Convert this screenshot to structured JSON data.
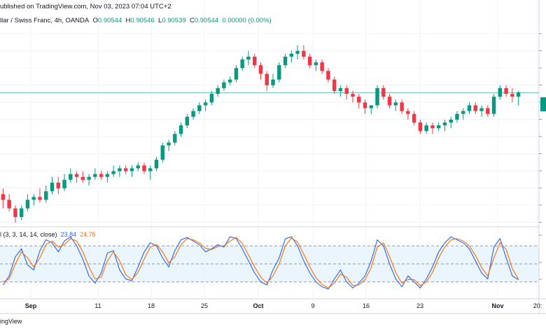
{
  "header": {
    "published_text": "ublished on TradingView.com, Nov 03, 2023 07:04 UTC+2",
    "symbol_text": "llar / Swiss Franc, 4h, OANDA",
    "ohlc": [
      {
        "label": "O",
        "value": "0.90544"
      },
      {
        "label": "H",
        "value": "0.90546"
      },
      {
        "label": "L",
        "value": "0.90539"
      },
      {
        "label": "C",
        "value": "0.90544"
      }
    ],
    "change": "0.00000 (0.00%)"
  },
  "stoch": {
    "title": "l (3, 3, 14, 14, close)",
    "k_value": "23.84",
    "d_value": "24.75"
  },
  "footer": {
    "text": "ingView"
  },
  "colors": {
    "up": "#089981",
    "down": "#f23645",
    "k_line": "#2962ff",
    "d_line": "#ff6d00",
    "band_fill": "#e3f2fd",
    "grid": "#f0f3fa",
    "last_price_line": "#089981"
  },
  "chart_data": [
    {
      "type": "candlestick",
      "title": "llar / Swiss Franc, 4h, OANDA",
      "x_tick_labels": [
        "Sep",
        "11",
        "18",
        "25",
        "Oct",
        "9",
        "16",
        "23",
        "Nov",
        "20:"
      ],
      "y_tick_labels": [],
      "ylim": [
        0.862,
        0.928
      ],
      "grid": true,
      "last_price": 0.90544,
      "candles": [
        [
          0.87,
          0.872,
          0.865,
          0.868
        ],
        [
          0.868,
          0.87,
          0.864,
          0.865
        ],
        [
          0.865,
          0.866,
          0.86,
          0.862
        ],
        [
          0.862,
          0.866,
          0.861,
          0.865
        ],
        [
          0.865,
          0.87,
          0.864,
          0.868
        ],
        [
          0.868,
          0.87,
          0.866,
          0.869
        ],
        [
          0.869,
          0.872,
          0.867,
          0.868
        ],
        [
          0.868,
          0.873,
          0.867,
          0.871
        ],
        [
          0.871,
          0.876,
          0.87,
          0.874
        ],
        [
          0.874,
          0.876,
          0.87,
          0.872
        ],
        [
          0.872,
          0.877,
          0.871,
          0.875
        ],
        [
          0.875,
          0.879,
          0.874,
          0.877
        ],
        [
          0.877,
          0.878,
          0.874,
          0.876
        ],
        [
          0.876,
          0.878,
          0.874,
          0.875
        ],
        [
          0.875,
          0.877,
          0.873,
          0.876
        ],
        [
          0.876,
          0.879,
          0.875,
          0.877
        ],
        [
          0.877,
          0.878,
          0.875,
          0.876
        ],
        [
          0.876,
          0.878,
          0.874,
          0.877
        ],
        [
          0.877,
          0.88,
          0.876,
          0.878
        ],
        [
          0.878,
          0.88,
          0.876,
          0.879
        ],
        [
          0.879,
          0.88,
          0.877,
          0.878
        ],
        [
          0.878,
          0.88,
          0.876,
          0.879
        ],
        [
          0.879,
          0.881,
          0.878,
          0.88
        ],
        [
          0.88,
          0.881,
          0.877,
          0.878
        ],
        [
          0.878,
          0.88,
          0.875,
          0.879
        ],
        [
          0.879,
          0.883,
          0.878,
          0.882
        ],
        [
          0.882,
          0.888,
          0.881,
          0.887
        ],
        [
          0.887,
          0.889,
          0.885,
          0.888
        ],
        [
          0.888,
          0.892,
          0.887,
          0.891
        ],
        [
          0.891,
          0.895,
          0.89,
          0.894
        ],
        [
          0.894,
          0.898,
          0.893,
          0.897
        ],
        [
          0.897,
          0.9,
          0.896,
          0.899
        ],
        [
          0.899,
          0.902,
          0.898,
          0.901
        ],
        [
          0.901,
          0.903,
          0.899,
          0.902
        ],
        [
          0.902,
          0.906,
          0.901,
          0.905
        ],
        [
          0.905,
          0.908,
          0.904,
          0.907
        ],
        [
          0.907,
          0.91,
          0.906,
          0.909
        ],
        [
          0.909,
          0.911,
          0.908,
          0.91
        ],
        [
          0.91,
          0.915,
          0.909,
          0.914
        ],
        [
          0.914,
          0.918,
          0.913,
          0.917
        ],
        [
          0.917,
          0.92,
          0.915,
          0.918
        ],
        [
          0.918,
          0.919,
          0.914,
          0.915
        ],
        [
          0.915,
          0.916,
          0.91,
          0.912
        ],
        [
          0.912,
          0.913,
          0.906,
          0.908
        ],
        [
          0.908,
          0.912,
          0.907,
          0.91
        ],
        [
          0.91,
          0.916,
          0.909,
          0.915
        ],
        [
          0.915,
          0.919,
          0.914,
          0.918
        ],
        [
          0.918,
          0.92,
          0.916,
          0.919
        ],
        [
          0.919,
          0.922,
          0.917,
          0.92
        ],
        [
          0.92,
          0.922,
          0.917,
          0.918
        ],
        [
          0.918,
          0.919,
          0.914,
          0.915
        ],
        [
          0.915,
          0.917,
          0.913,
          0.916
        ],
        [
          0.916,
          0.917,
          0.912,
          0.913
        ],
        [
          0.913,
          0.914,
          0.909,
          0.91
        ],
        [
          0.91,
          0.911,
          0.905,
          0.906
        ],
        [
          0.906,
          0.908,
          0.904,
          0.907
        ],
        [
          0.907,
          0.908,
          0.903,
          0.905
        ],
        [
          0.905,
          0.906,
          0.902,
          0.904
        ],
        [
          0.904,
          0.905,
          0.9,
          0.902
        ],
        [
          0.902,
          0.903,
          0.898,
          0.9
        ],
        [
          0.9,
          0.901,
          0.898,
          0.901
        ],
        [
          0.901,
          0.908,
          0.9,
          0.907
        ],
        [
          0.907,
          0.908,
          0.903,
          0.904
        ],
        [
          0.904,
          0.905,
          0.9,
          0.901
        ],
        [
          0.901,
          0.903,
          0.899,
          0.902
        ],
        [
          0.902,
          0.903,
          0.898,
          0.899
        ],
        [
          0.899,
          0.9,
          0.896,
          0.898
        ],
        [
          0.898,
          0.899,
          0.894,
          0.895
        ],
        [
          0.895,
          0.896,
          0.891,
          0.892
        ],
        [
          0.892,
          0.895,
          0.891,
          0.894
        ],
        [
          0.894,
          0.895,
          0.891,
          0.893
        ],
        [
          0.893,
          0.895,
          0.892,
          0.894
        ],
        [
          0.894,
          0.896,
          0.892,
          0.895
        ],
        [
          0.895,
          0.897,
          0.893,
          0.896
        ],
        [
          0.896,
          0.899,
          0.895,
          0.898
        ],
        [
          0.898,
          0.9,
          0.896,
          0.899
        ],
        [
          0.899,
          0.902,
          0.898,
          0.901
        ],
        [
          0.901,
          0.902,
          0.898,
          0.899
        ],
        [
          0.899,
          0.901,
          0.897,
          0.9
        ],
        [
          0.9,
          0.901,
          0.897,
          0.898
        ],
        [
          0.898,
          0.905,
          0.897,
          0.904
        ],
        [
          0.904,
          0.908,
          0.903,
          0.907
        ],
        [
          0.907,
          0.908,
          0.904,
          0.905
        ],
        [
          0.905,
          0.907,
          0.902,
          0.904
        ],
        [
          0.904,
          0.906,
          0.901,
          0.9055
        ]
      ]
    },
    {
      "type": "line",
      "title": "l (3, 3, 14, 14, close)",
      "ylim": [
        0,
        100
      ],
      "band": [
        20,
        80
      ],
      "midline": 50,
      "series": [
        {
          "name": "23.84",
          "values": [
            15,
            30,
            62,
            75,
            48,
            40,
            72,
            90,
            85,
            70,
            88,
            95,
            80,
            58,
            30,
            18,
            35,
            68,
            72,
            40,
            25,
            22,
            45,
            70,
            85,
            80,
            60,
            45,
            72,
            90,
            94,
            88,
            82,
            70,
            75,
            82,
            78,
            95,
            92,
            75,
            55,
            35,
            20,
            15,
            40,
            60,
            92,
            95,
            80,
            55,
            35,
            20,
            12,
            8,
            25,
            40,
            20,
            10,
            18,
            30,
            55,
            90,
            80,
            50,
            25,
            12,
            30,
            20,
            10,
            25,
            45,
            70,
            85,
            95,
            90,
            85,
            75,
            55,
            35,
            25,
            78,
            92,
            60,
            30,
            23.84
          ]
        },
        {
          "name": "24.75",
          "values": [
            20,
            25,
            50,
            70,
            60,
            45,
            60,
            82,
            88,
            78,
            82,
            92,
            88,
            70,
            45,
            25,
            28,
            55,
            70,
            55,
            32,
            24,
            36,
            58,
            78,
            82,
            70,
            52,
            62,
            82,
            92,
            90,
            85,
            76,
            74,
            79,
            80,
            88,
            94,
            84,
            65,
            45,
            28,
            18,
            30,
            50,
            80,
            93,
            86,
            66,
            45,
            27,
            16,
            10,
            18,
            33,
            28,
            14,
            15,
            24,
            44,
            78,
            85,
            62,
            36,
            18,
            24,
            24,
            14,
            20,
            36,
            60,
            78,
            90,
            92,
            88,
            80,
            64,
            44,
            30,
            60,
            85,
            74,
            42,
            24.75
          ]
        }
      ]
    }
  ]
}
